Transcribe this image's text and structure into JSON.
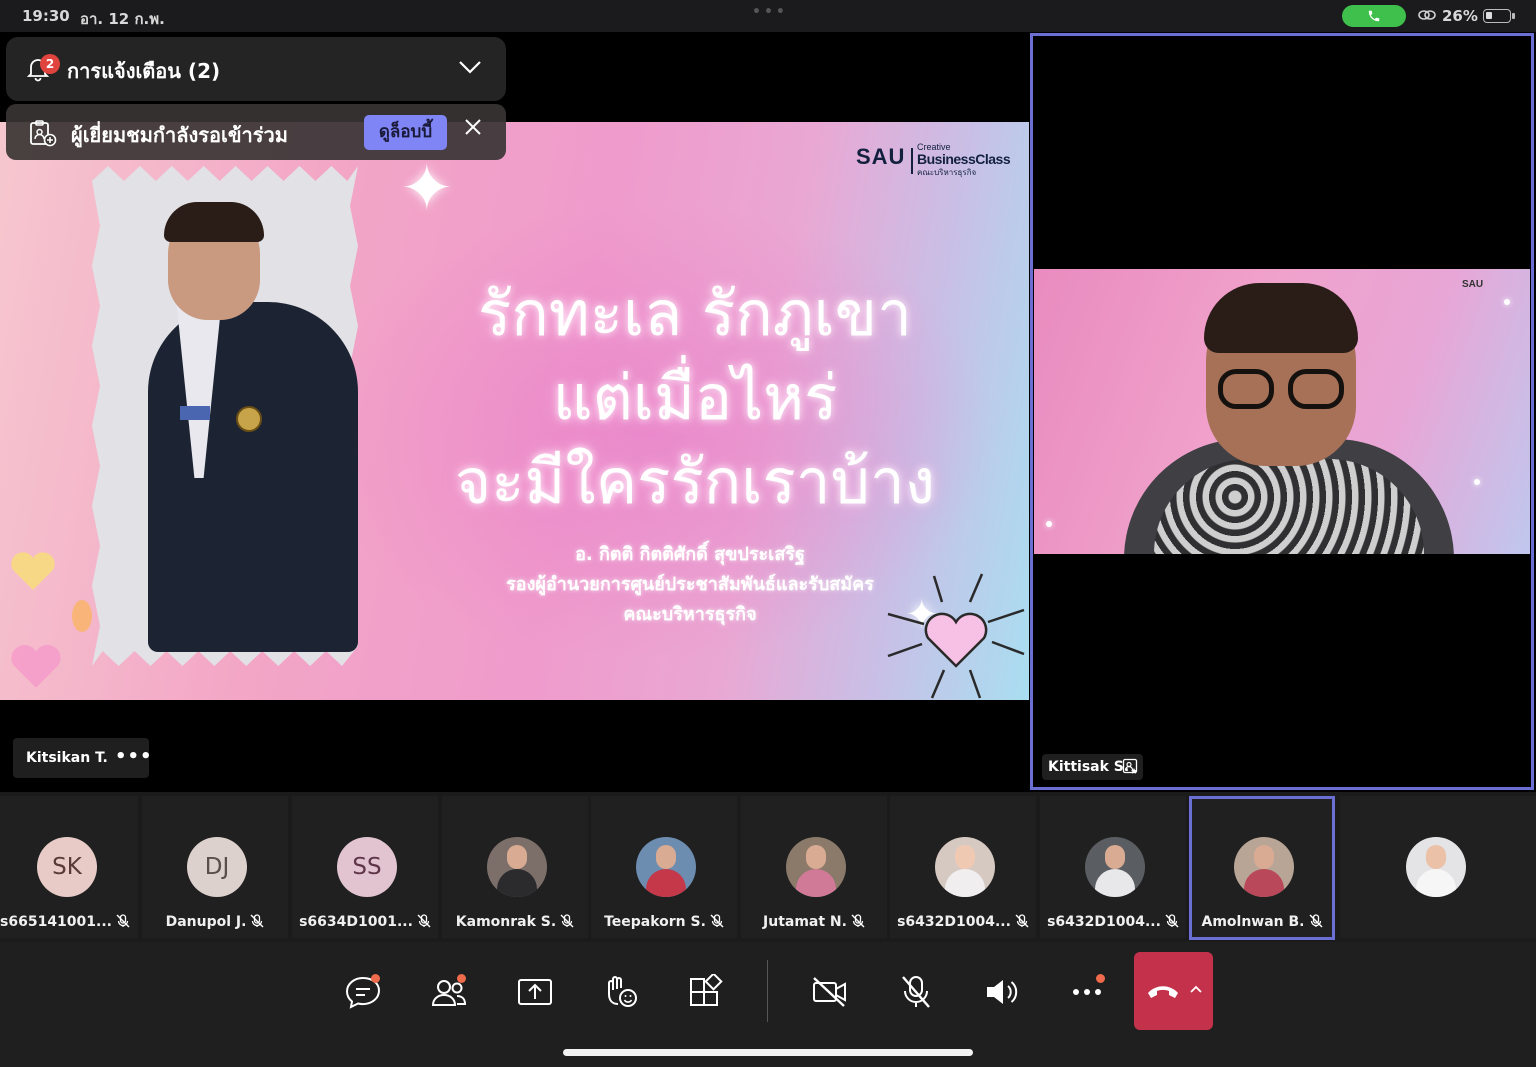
{
  "status_bar": {
    "time": "19:30",
    "date": "อา. 12 ก.พ.",
    "battery": "26%",
    "battery_level": 0.26
  },
  "notifications": {
    "title": "การแจ้งเตือน (2)",
    "count": "2",
    "lobby_message": "ผู้เยี่ยมชมกำลังรอเข้าร่วม",
    "lobby_action": "ดูล็อบบี้"
  },
  "slide": {
    "logo": {
      "brand": "SAU",
      "creative": "Creative",
      "business_class": "BusinessClass",
      "faculty": "คณะบริหารธุรกิจ"
    },
    "title_lines": [
      "รักทะเล รักภูเขา",
      "แต่เมื่อไหร่",
      "จะมีใครรักเราบ้าง"
    ],
    "subtitle_lines": [
      "อ. กิตติ กิตติศักดิ์ สุขประเสริฐ",
      "รองผู้อำนวยการศูนย์ประชาสัมพันธ์และรับสมัคร",
      "คณะบริหารธุรกิจ"
    ]
  },
  "presenter": {
    "name": "Kitsikan T.",
    "more": "•••"
  },
  "speaker": {
    "name": "Kittisak S.",
    "video_logo": "SAU"
  },
  "participants": [
    {
      "initials": "SK",
      "name": "s665141001..."
    },
    {
      "initials": "DJ",
      "name": "Danupol J."
    },
    {
      "initials": "SS",
      "name": "s6634D1001..."
    },
    {
      "initials": "",
      "name": "Kamonrak S."
    },
    {
      "initials": "",
      "name": "Teepakorn S."
    },
    {
      "initials": "",
      "name": "Jutamat N."
    },
    {
      "initials": "",
      "name": "s6432D1004..."
    },
    {
      "initials": "",
      "name": "s6432D1004..."
    },
    {
      "initials": "",
      "name": "Amolnwan B."
    },
    {
      "initials": "",
      "name": ""
    }
  ],
  "controls": {
    "icons": [
      "chat-icon",
      "people-icon",
      "share-screen-icon",
      "react-icon",
      "apps-icon",
      "camera-off-icon",
      "mic-off-icon",
      "speaker-icon",
      "more-icon",
      "hang-up-icon"
    ]
  },
  "colors": {
    "accent": "#6b6fd4",
    "lobby_button": "#7f85f5",
    "hangup": "#c4314b",
    "notif_badge": "#e0443e",
    "call_pill": "#3fbf4b"
  }
}
